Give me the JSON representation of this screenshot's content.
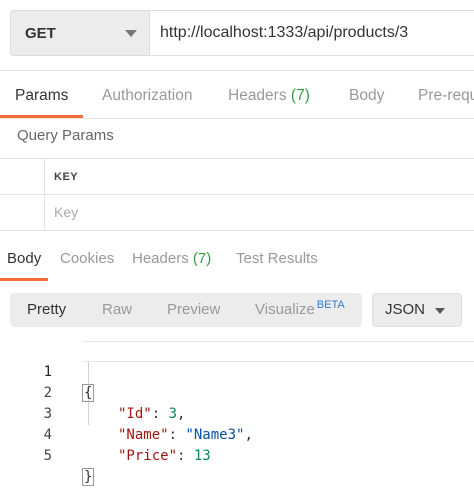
{
  "request": {
    "method": "GET",
    "url": "http://localhost:1333/api/products/3"
  },
  "request_tabs": [
    {
      "label": "Params",
      "count": ""
    },
    {
      "label": "Authorization",
      "count": ""
    },
    {
      "label": "Headers",
      "count": "(7)"
    },
    {
      "label": "Body",
      "count": ""
    },
    {
      "label": "Pre-requ",
      "count": ""
    }
  ],
  "query_params": {
    "title": "Query Params",
    "key_header": "KEY",
    "key_placeholder": "Key"
  },
  "response_tabs": [
    {
      "label": "Body",
      "count": ""
    },
    {
      "label": "Cookies",
      "count": ""
    },
    {
      "label": "Headers",
      "count": "(7)"
    },
    {
      "label": "Test Results",
      "count": ""
    }
  ],
  "format": {
    "options": [
      "Pretty",
      "Raw",
      "Preview",
      "Visualize"
    ],
    "beta": "BETA",
    "language": "JSON"
  },
  "code": {
    "line_numbers": [
      "1",
      "2",
      "3",
      "4",
      "5"
    ],
    "open_brace": "{",
    "close_brace": "}",
    "id_key": "\"Id\"",
    "id_value": "3",
    "name_key": "\"Name\"",
    "name_value": "\"Name3\"",
    "price_key": "\"Price\"",
    "price_value": "13"
  },
  "colors": {
    "accent": "#f26b3a",
    "count_green": "#3a9a42",
    "beta_blue": "#2a7fd6"
  }
}
